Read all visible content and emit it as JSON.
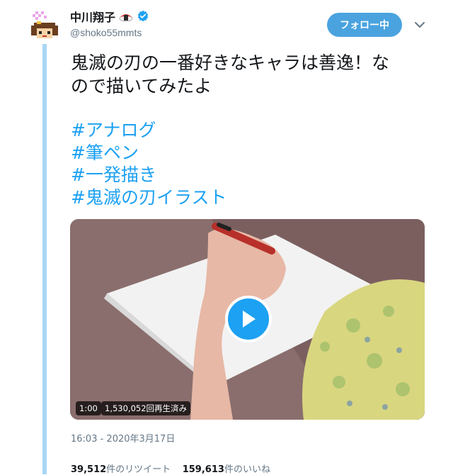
{
  "author": {
    "display_name": "中川翔子",
    "handle": "@shoko55mmts",
    "avatar_icon": "pixel-avatar-icon",
    "name_emoji_icon": "sushi-icon",
    "verified_icon": "verified-badge-icon"
  },
  "header": {
    "follow_label": "フォロー中",
    "menu_icon": "chevron-down-icon"
  },
  "tweet": {
    "text_line1": "鬼滅の刃の一番好きなキャラは善逸！な",
    "text_line2": "ので描いてみたよ",
    "hashtags": [
      "#アナログ",
      "#筆ペン",
      "#一発描き",
      "#鬼滅の刃イラスト"
    ]
  },
  "video": {
    "duration": "1:00",
    "views": "1,530,052回再生済み",
    "play_icon": "play-icon"
  },
  "meta": {
    "timestamp": "16:03 - 2020年3月17日"
  },
  "stats": {
    "retweets": "39,512",
    "retweets_label": "件のリツイート",
    "likes": "159,613",
    "likes_label": "件のいいね"
  },
  "colors": {
    "accent": "#1da1f2",
    "follow_button": "#4aa3df",
    "thread_line": "#a9d6f5",
    "muted_text": "#657786"
  }
}
